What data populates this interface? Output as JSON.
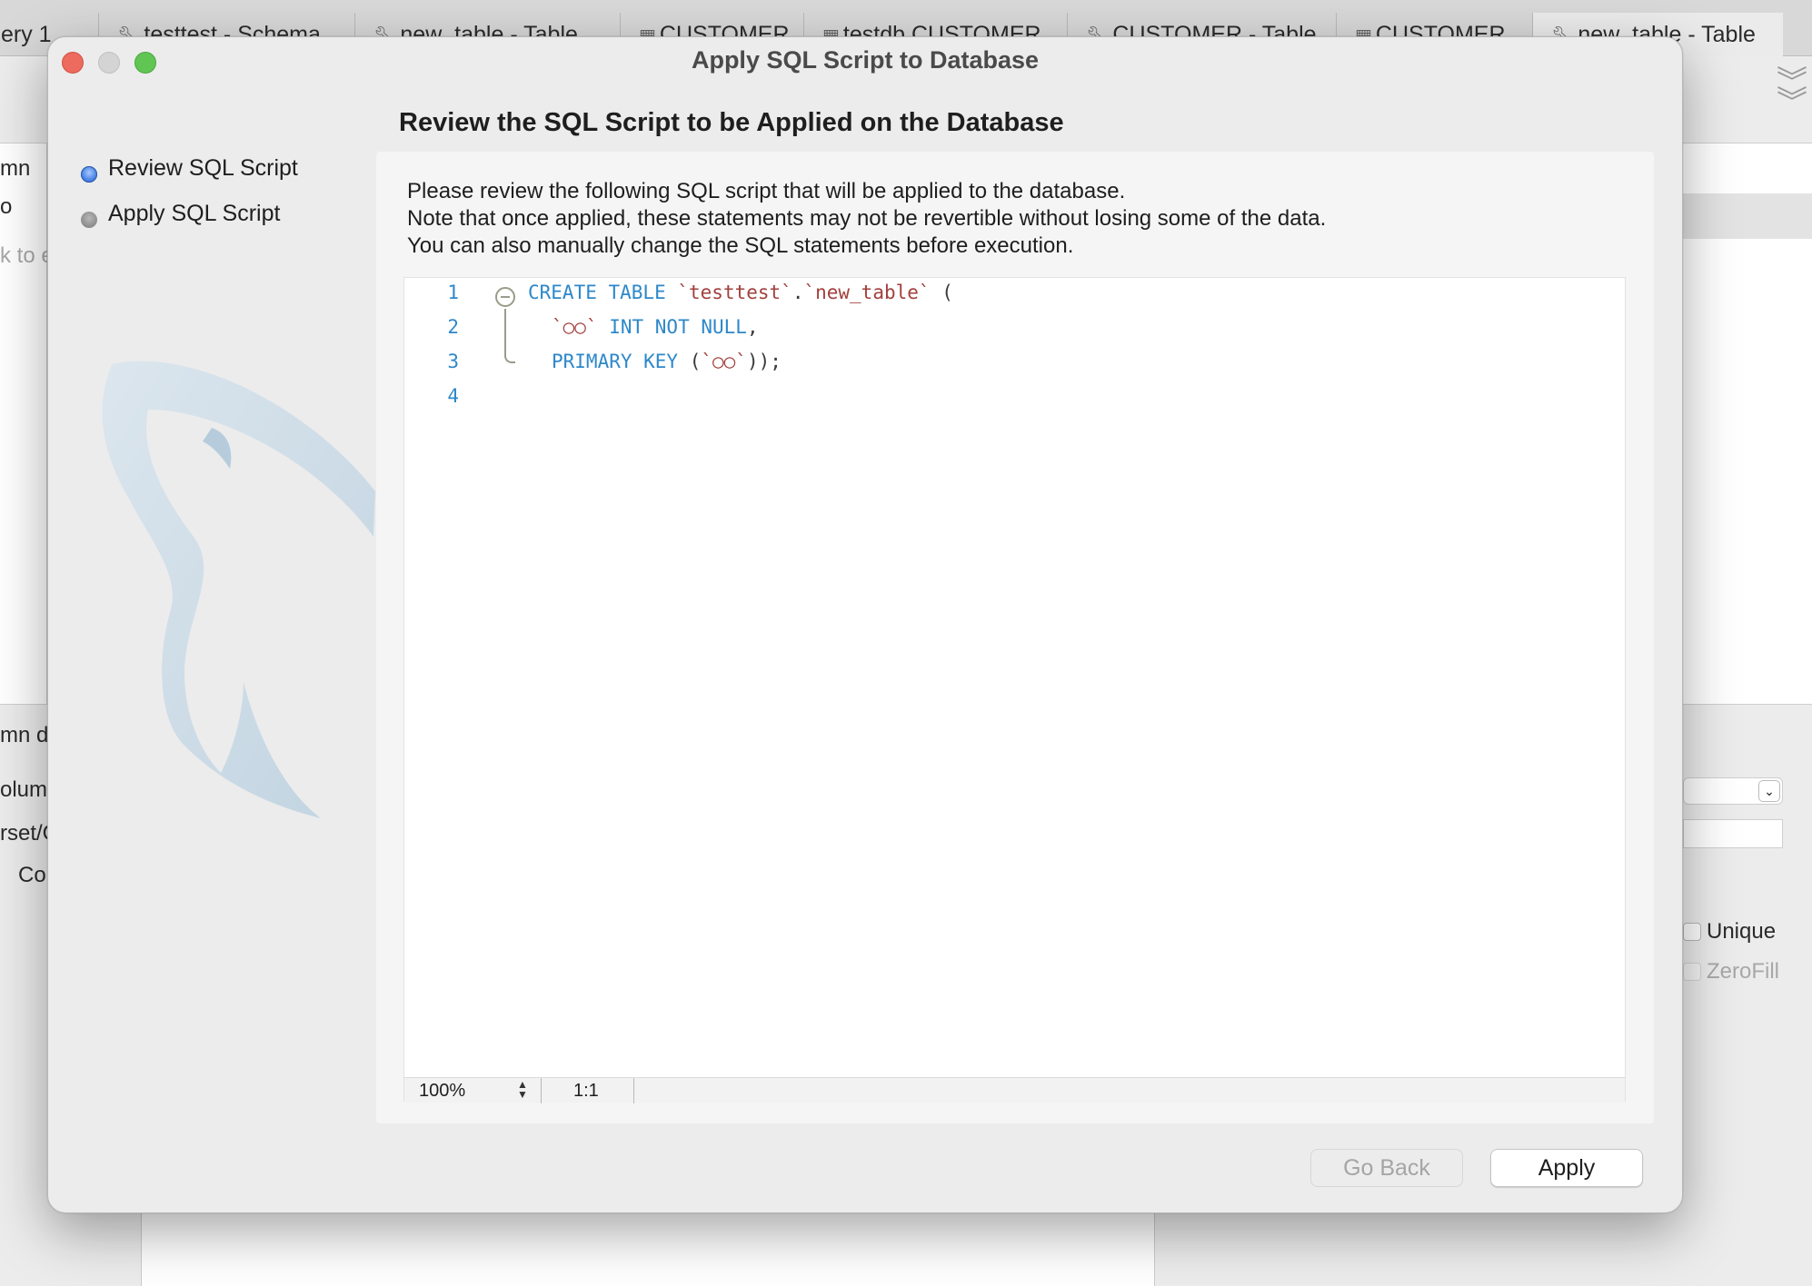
{
  "background_tabs": [
    {
      "label": "ery 1",
      "icon": ""
    },
    {
      "label": "testtest - Schema",
      "icon": "wrench-icon"
    },
    {
      "label": "new_table - Table",
      "icon": "wrench-icon"
    },
    {
      "label": "CUSTOMER",
      "icon": "table-icon"
    },
    {
      "label": "testdb.CUSTOMER",
      "icon": "table-icon"
    },
    {
      "label": "CUSTOMER - Table",
      "icon": "wrench-icon"
    },
    {
      "label": "CUSTOMER",
      "icon": "table-icon"
    },
    {
      "label": "new_table - Table",
      "icon": "wrench-icon"
    }
  ],
  "background_fragments": {
    "left": [
      "mn",
      "o",
      "k to e",
      "mn d",
      "olum",
      "rset/C",
      "Co"
    ],
    "right_checks": [
      "Unique",
      "ZeroFill"
    ]
  },
  "dialog": {
    "title": "Apply SQL Script to Database",
    "heading": "Review the SQL Script to be Applied on the Database",
    "steps": [
      {
        "label": "Review SQL Script",
        "active": true
      },
      {
        "label": "Apply SQL Script",
        "active": false
      }
    ],
    "description": [
      "Please review the following SQL script that will be applied to the database.",
      "Note that once applied, these statements may not be revertible without losing some of the data.",
      "You can also manually change the SQL statements before execution."
    ],
    "editor": {
      "line_numbers": [
        "1",
        "2",
        "3",
        "4"
      ],
      "tokens": {
        "l1_create": "CREATE TABLE ",
        "l1_schema": "`testtest`",
        "l1_dot": ".",
        "l1_table": "`new_table`",
        "l1_paren": " (",
        "l2_col": "`○○`",
        "l2_type": " INT NOT NULL",
        "l2_comma": ",",
        "l3_pk": "PRIMARY KEY",
        "l3_open": " (",
        "l3_col": "`○○`",
        "l3_close": "));"
      },
      "zoom": "100%",
      "cursor_position": "1:1"
    },
    "buttons": {
      "go_back": "Go Back",
      "apply": "Apply"
    },
    "colors": {
      "keyword": "#2e88c9",
      "identifier": "#a2403d",
      "close": "#ed6a5e",
      "maximize": "#61c554"
    }
  }
}
